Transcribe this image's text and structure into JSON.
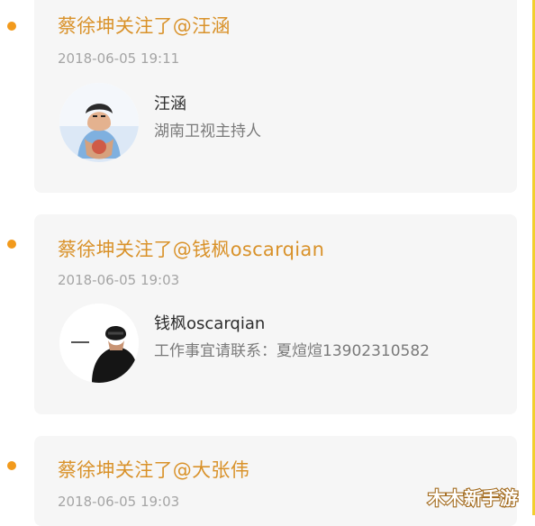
{
  "feed": {
    "items": [
      {
        "event_title": "蔡徐坤关注了@汪涵",
        "timestamp": "2018-06-05 19:11",
        "user": {
          "name": "汪涵",
          "description": "湖南卫视主持人"
        }
      },
      {
        "event_title": "蔡徐坤关注了@钱枫oscarqian",
        "timestamp": "2018-06-05 19:03",
        "user": {
          "name": "钱枫oscarqian",
          "description": "工作事宜请联系：夏煊煊13902310582"
        }
      },
      {
        "event_title": "蔡徐坤关注了@大张伟",
        "timestamp": "2018-06-05 19:03"
      }
    ]
  },
  "watermark": {
    "text": "木木新手游"
  },
  "colors": {
    "accent_orange": "#d9922a",
    "dot_orange": "#f29a1c",
    "card_background": "#f6f6f6",
    "timestamp_gray": "#a5a5a5",
    "right_border_yellow": "#f2cf2e"
  }
}
